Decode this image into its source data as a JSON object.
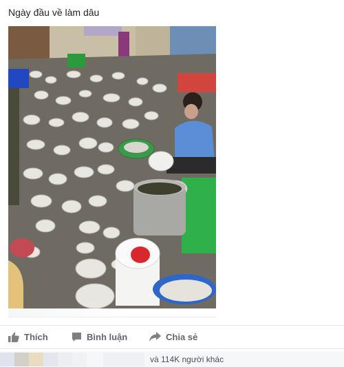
{
  "post": {
    "text": "Ngày đầu về làm dâu"
  },
  "photo": {
    "subject": "dishes"
  },
  "actions": {
    "like_label": "Thích",
    "comment_label": "Bình luận",
    "share_label": "Chia sẻ"
  },
  "footer": {
    "likes_text": "và 114K người khác"
  },
  "colors": {
    "action_text": "#606770",
    "post_text": "#1d2129",
    "footer_bg": "#f6f7f9"
  }
}
